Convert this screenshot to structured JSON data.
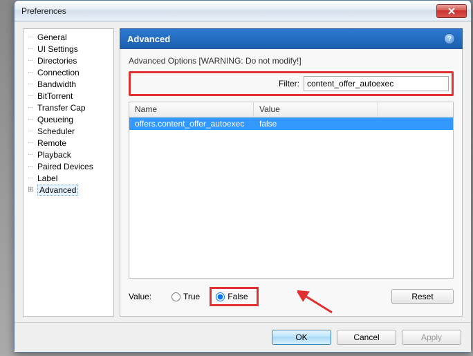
{
  "window": {
    "title": "Preferences"
  },
  "sidebar": {
    "items": [
      {
        "label": "General"
      },
      {
        "label": "UI Settings"
      },
      {
        "label": "Directories"
      },
      {
        "label": "Connection"
      },
      {
        "label": "Bandwidth"
      },
      {
        "label": "BitTorrent"
      },
      {
        "label": "Transfer Cap"
      },
      {
        "label": "Queueing"
      },
      {
        "label": "Scheduler"
      },
      {
        "label": "Remote"
      },
      {
        "label": "Playback"
      },
      {
        "label": "Paired Devices"
      },
      {
        "label": "Label"
      },
      {
        "label": "Advanced",
        "expandable": true,
        "selected": true
      }
    ]
  },
  "panel": {
    "title": "Advanced",
    "warning": "Advanced Options [WARNING: Do not modify!]",
    "filter_label": "Filter:",
    "filter_value": "content_offer_autoexec",
    "columns": {
      "name": "Name",
      "value": "Value"
    },
    "rows": [
      {
        "name": "offers.content_offer_autoexec",
        "value": "false",
        "selected": true
      }
    ],
    "value_label": "Value:",
    "radio_true": "True",
    "radio_false": "False",
    "selected_radio": "false",
    "reset_label": "Reset"
  },
  "footer": {
    "ok": "OK",
    "cancel": "Cancel",
    "apply": "Apply"
  }
}
